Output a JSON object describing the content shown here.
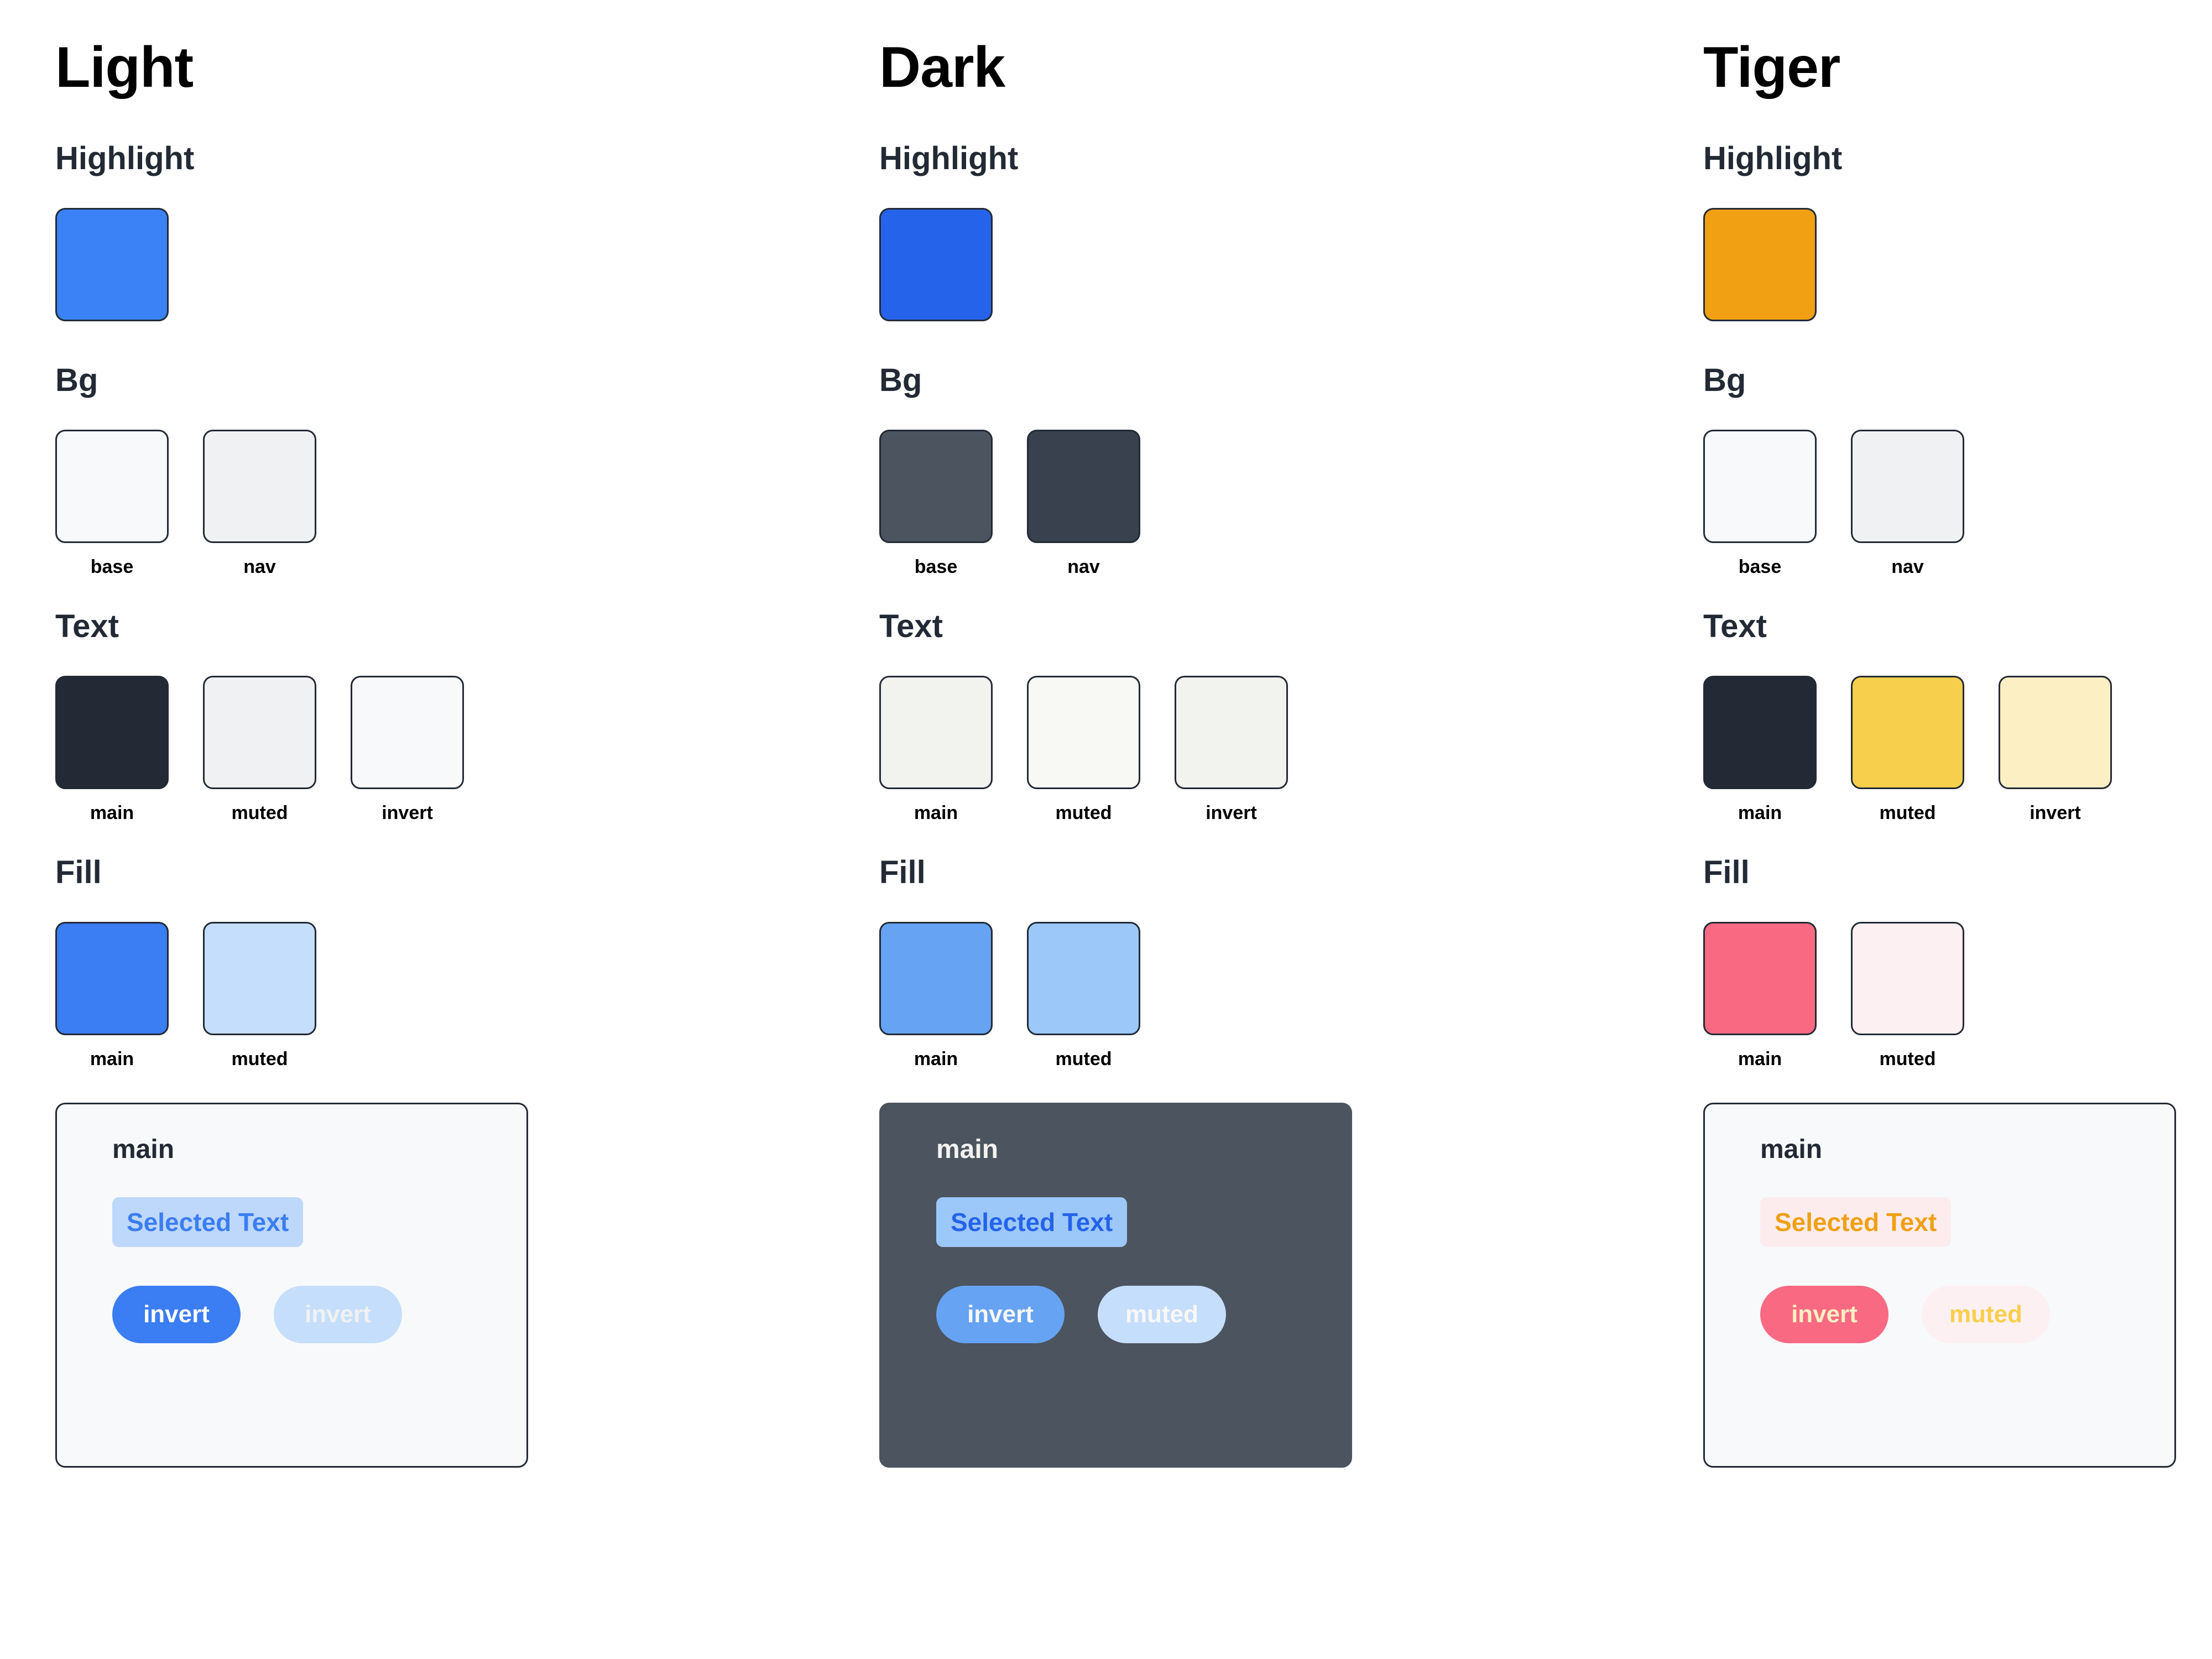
{
  "themes": [
    {
      "name": "Light",
      "sections": {
        "highlight": {
          "title": "Highlight",
          "swatches": [
            {
              "label": "",
              "color": "#3B82F6"
            }
          ]
        },
        "bg": {
          "title": "Bg",
          "swatches": [
            {
              "label": "base",
              "color": "#F7F9FB"
            },
            {
              "label": "nav",
              "color": "#F0F1F2"
            }
          ]
        },
        "text": {
          "title": "Text",
          "swatches": [
            {
              "label": "main",
              "color": "#232A35"
            },
            {
              "label": "muted",
              "color": "#F0F1F2"
            },
            {
              "label": "invert",
              "color": "#F7F9FB"
            }
          ]
        },
        "fill": {
          "title": "Fill",
          "swatches": [
            {
              "label": "main",
              "color": "#3B7DF2"
            },
            {
              "label": "muted",
              "color": "#C5DEFB"
            }
          ]
        }
      },
      "demo": {
        "card_bg": "#F7F9FB",
        "card_border": "#232A35",
        "main_label": "main",
        "main_label_color": "#232A35",
        "selected_text": "Selected Text",
        "selected_text_color": "#3B7DF2",
        "selected_text_bg": "#BDD8FB",
        "buttons": [
          {
            "label": "invert",
            "bg": "#3B7DF2",
            "color": "#FFFFFF"
          },
          {
            "label": "invert",
            "bg": "#C5DEFB",
            "color": "#F0F1F2"
          }
        ]
      }
    },
    {
      "name": "Dark",
      "sections": {
        "highlight": {
          "title": "Highlight",
          "swatches": [
            {
              "label": "",
              "color": "#2563EB"
            }
          ]
        },
        "bg": {
          "title": "Bg",
          "swatches": [
            {
              "label": "base",
              "color": "#4C545F"
            },
            {
              "label": "nav",
              "color": "#39414F"
            }
          ]
        },
        "text": {
          "title": "Text",
          "swatches": [
            {
              "label": "main",
              "color": "#F2F2EF"
            },
            {
              "label": "muted",
              "color": "#F8F8F5"
            },
            {
              "label": "invert",
              "color": "#F2F2EF"
            }
          ]
        },
        "fill": {
          "title": "Fill",
          "swatches": [
            {
              "label": "main",
              "color": "#66A3F2"
            },
            {
              "label": "muted",
              "color": "#9BC8F9"
            }
          ]
        }
      },
      "demo": {
        "card_bg": "#4C545F",
        "card_border": "#4C545F",
        "main_label": "main",
        "main_label_color": "#F2F2EF",
        "selected_text": "Selected Text",
        "selected_text_color": "#2563EB",
        "selected_text_bg": "#9BC8F9",
        "buttons": [
          {
            "label": "invert",
            "bg": "#66A3F2",
            "color": "#F8F8F5"
          },
          {
            "label": "muted",
            "bg": "#C5DEFB",
            "color": "#F8F8F5"
          }
        ]
      }
    },
    {
      "name": "Tiger",
      "sections": {
        "highlight": {
          "title": "Highlight",
          "swatches": [
            {
              "label": "",
              "color": "#F0A012"
            }
          ]
        },
        "bg": {
          "title": "Bg",
          "swatches": [
            {
              "label": "base",
              "color": "#F7F9FB"
            },
            {
              "label": "nav",
              "color": "#F0F1F2"
            }
          ]
        },
        "text": {
          "title": "Text",
          "swatches": [
            {
              "label": "main",
              "color": "#232A35"
            },
            {
              "label": "muted",
              "color": "#F8CF4C"
            },
            {
              "label": "invert",
              "color": "#FBEFC3"
            }
          ]
        },
        "fill": {
          "title": "Fill",
          "swatches": [
            {
              "label": "main",
              "color": "#F96A82"
            },
            {
              "label": "muted",
              "color": "#FDF0F2"
            }
          ]
        }
      },
      "demo": {
        "card_bg": "#F7F9FB",
        "card_border": "#232A35",
        "main_label": "main",
        "main_label_color": "#232A35",
        "selected_text": "Selected Text",
        "selected_text_color": "#F0A012",
        "selected_text_bg": "#FDECEE",
        "buttons": [
          {
            "label": "invert",
            "bg": "#F96A82",
            "color": "#FBEFC3"
          },
          {
            "label": "muted",
            "bg": "#FDF0F2",
            "color": "#F8CF4C"
          }
        ]
      }
    }
  ]
}
